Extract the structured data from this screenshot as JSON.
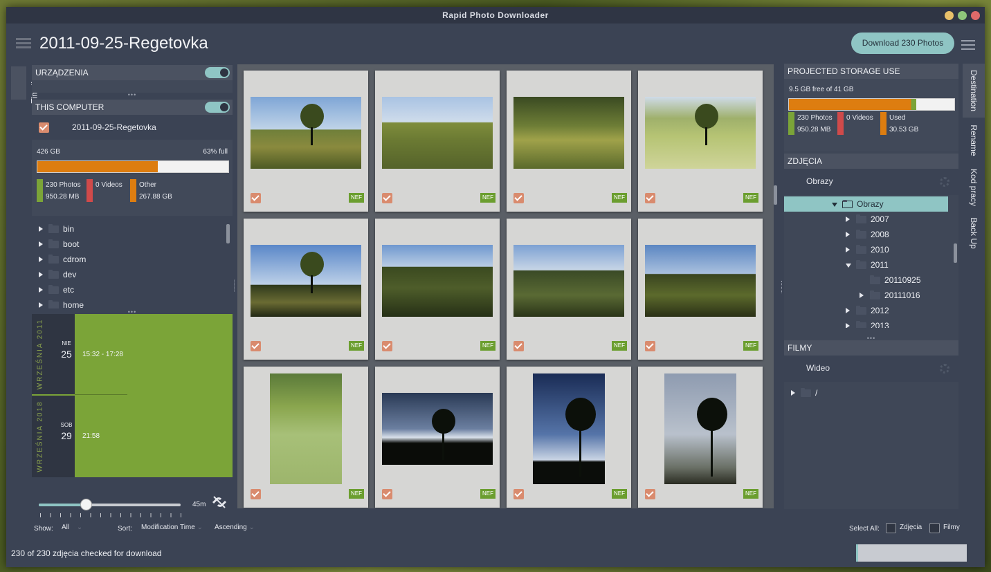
{
  "window": {
    "title": "Rapid Photo Downloader"
  },
  "header": {
    "folder_title": "2011-09-25-Regetovka",
    "download_button": "Download 230 Photos"
  },
  "left_tabs": {
    "timeline": "Timeline"
  },
  "devices": {
    "title": "URZĄDZENIA",
    "this_computer": "THIS COMPUTER",
    "source_name": "2011-09-25-Regetovka",
    "capacity": "426 GB",
    "percent_full": "63% full",
    "usage_fill": 0.63,
    "legend": [
      {
        "line1": "230 Photos",
        "line2": "950.28 MB",
        "color": "#7ba438"
      },
      {
        "line1": "0 Videos",
        "line2": "",
        "color": "#d04a4a"
      },
      {
        "line1": "Other",
        "line2": "267.88 GB",
        "color": "#dd7d10"
      }
    ],
    "folders": [
      "bin",
      "boot",
      "cdrom",
      "dev",
      "etc",
      "home"
    ]
  },
  "timeline": [
    {
      "month": "WRZEŚNIA 2011",
      "weekday": "NIE",
      "day": "25",
      "range": "15:32 - 17:28"
    },
    {
      "month": "WRZEŚNIA 2018",
      "weekday": "SOB",
      "day": "29",
      "range": "21:58"
    }
  ],
  "slider": {
    "value_label": "45m",
    "fraction": 0.3
  },
  "thumbnails": {
    "badge": "NEF"
  },
  "destination": {
    "storage_title": "PROJECTED STORAGE USE",
    "free_text": "9.5 GB free of 41 GB",
    "usage_fill": 0.77,
    "legend": [
      {
        "line1": "230 Photos",
        "line2": "950.28 MB",
        "color": "#7ba438"
      },
      {
        "line1": "0 Videos",
        "line2": "",
        "color": "#d04a4a"
      },
      {
        "line1": "Used",
        "line2": "30.53 GB",
        "color": "#dd7d10"
      }
    ],
    "photos_title": "ZDJĘCIA",
    "photos_dest": "Obrazy",
    "tree": [
      {
        "label": "Obrazy",
        "indent": 0,
        "state": "open",
        "selected": true
      },
      {
        "label": "2007",
        "indent": 1,
        "state": "closed"
      },
      {
        "label": "2008",
        "indent": 1,
        "state": "closed"
      },
      {
        "label": "2010",
        "indent": 1,
        "state": "closed"
      },
      {
        "label": "2011",
        "indent": 1,
        "state": "open"
      },
      {
        "label": "20110925",
        "indent": 2,
        "state": "none"
      },
      {
        "label": "20111016",
        "indent": 2,
        "state": "closed"
      },
      {
        "label": "2012",
        "indent": 1,
        "state": "closed"
      },
      {
        "label": "2013",
        "indent": 1,
        "state": "closed"
      }
    ],
    "videos_title": "FILMY",
    "videos_dest": "Wideo",
    "videos_root": "/"
  },
  "right_tabs": [
    "Destination",
    "Rename",
    "Kod pracy",
    "Back Up"
  ],
  "bottom": {
    "show_label": "Show:",
    "show_value": "All",
    "sort_label": "Sort:",
    "sort_value": "Modification Time",
    "order_value": "Ascending",
    "select_all_label": "Select All:",
    "photos_cb": "Zdjęcia",
    "videos_cb": "Filmy"
  },
  "status": {
    "text": "230 of 230 zdjęcia checked for download"
  }
}
